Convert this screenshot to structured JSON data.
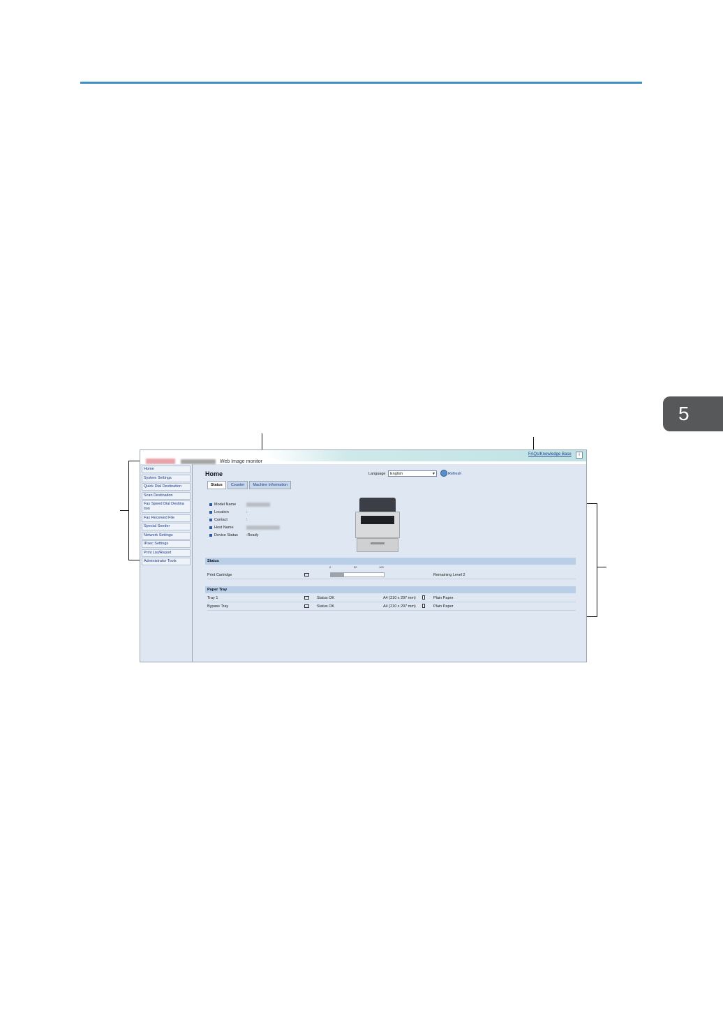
{
  "chapter": {
    "number": "5"
  },
  "header": {
    "app_title": "Web Image monitor",
    "faq_link": "FAQs/Knowledge Base",
    "help_icon": "i"
  },
  "sidebar": {
    "items": [
      {
        "label": "Home"
      },
      {
        "label": "System Settings"
      },
      {
        "label": "Quick Dial Destination"
      },
      {
        "label": "Scan Destination"
      },
      {
        "label": "Fax Speed Dial Destina tion"
      },
      {
        "label": "Fax Received File"
      },
      {
        "label": "Special Sender"
      },
      {
        "label": "Network Settings"
      },
      {
        "label": "IPsec Settings"
      },
      {
        "label": "Print List/Report"
      },
      {
        "label": "Administrator Tools"
      }
    ]
  },
  "main": {
    "title": "Home",
    "language_label": "Language",
    "language_value": "English",
    "refresh_label": "Refresh",
    "tabs": [
      {
        "label": "Status"
      },
      {
        "label": "Counter"
      },
      {
        "label": "Machine Information"
      }
    ],
    "info": [
      {
        "label": "Model Name",
        "value": ""
      },
      {
        "label": "Location",
        "value": ":"
      },
      {
        "label": "Contact",
        "value": ":"
      },
      {
        "label": "Host Name",
        "value": ""
      },
      {
        "label": "Device Status",
        "value": ":Ready"
      }
    ]
  },
  "status_section": {
    "title": "Status",
    "scale": [
      "0",
      "50",
      "100"
    ],
    "cartridge_label": "Print Cartridge",
    "cartridge_level_fraction": 0.25,
    "remaining": "Remaining Level 2"
  },
  "paper_section": {
    "title": "Paper Tray",
    "rows": [
      {
        "name": "Tray 1",
        "status": "Status OK",
        "size": "A4 (210 x 297 mm)",
        "type": "Plain Paper"
      },
      {
        "name": "Bypass Tray",
        "status": "Status OK",
        "size": "A4 (210 x 297 mm)",
        "type": "Plain Paper"
      }
    ]
  }
}
